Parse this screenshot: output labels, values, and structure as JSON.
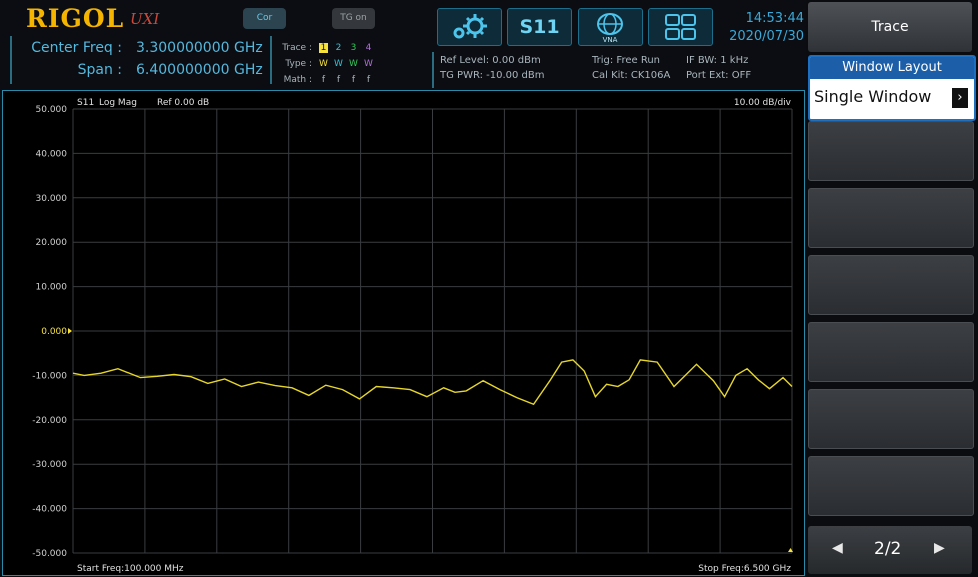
{
  "brand": {
    "logo": "RIGOL",
    "series": "UXI"
  },
  "toggles": {
    "cor": "Cor",
    "tg": "TG on"
  },
  "frequency": {
    "center_label": "Center Freq :",
    "center_value": "3.300000000 GHz",
    "span_label": "Span :",
    "span_value": "6.400000000 GHz"
  },
  "trace_table": {
    "trace_label": "Trace :",
    "type_label": "Type :",
    "math_label": "Math :",
    "traces": [
      "1",
      "2",
      "3",
      "4"
    ],
    "types": [
      "W",
      "W",
      "W",
      "W"
    ],
    "math": [
      "f",
      "f",
      "f",
      "f"
    ]
  },
  "toolbar": {
    "measurement": "S11",
    "vna_label": "VNA"
  },
  "clock": {
    "time": "14:53:44",
    "date": "2020/07/30"
  },
  "status": {
    "ref_level": "Ref Level: 0.00 dBm",
    "tg_pwr": "TG PWR: -10.00 dBm",
    "trig": "Trig: Free Run",
    "cal_kit": "Cal Kit: CK106A",
    "if_bw": "IF BW: 1 kHz",
    "port_ext": "Port Ext: OFF"
  },
  "plot": {
    "measurement_label": "S11",
    "format_label": "Log Mag",
    "ref_label": "Ref 0.00 dB",
    "scale_label": "10.00  dB/div",
    "start_label": "Start Freq:100.000 MHz",
    "stop_label": "Stop Freq:6.500 GHz"
  },
  "chart_data": {
    "type": "line",
    "title": "S11 Log Mag",
    "xlabel": "",
    "ylabel": "",
    "xlim": [
      0.1,
      6.5
    ],
    "ylim": [
      -50,
      50
    ],
    "y_ticks": [
      "50.000",
      "40.000",
      "30.000",
      "20.000",
      "10.000",
      "0.000",
      "-10.000",
      "-20.000",
      "-30.000",
      "-40.000",
      "-50.000"
    ],
    "reference_value": 0,
    "grid": true,
    "series": [
      {
        "color": "#e6d62a",
        "x": [
          0.1,
          0.2,
          0.35,
          0.5,
          0.7,
          0.85,
          1.0,
          1.15,
          1.3,
          1.45,
          1.6,
          1.75,
          1.9,
          2.05,
          2.2,
          2.35,
          2.5,
          2.65,
          2.8,
          2.95,
          3.1,
          3.25,
          3.4,
          3.5,
          3.6,
          3.75,
          3.9,
          4.05,
          4.2,
          4.35,
          4.45,
          4.55,
          4.65,
          4.75,
          4.85,
          4.95,
          5.05,
          5.15,
          5.3,
          5.45,
          5.55,
          5.65,
          5.8,
          5.9,
          6.0,
          6.1,
          6.2,
          6.3,
          6.42,
          6.5
        ],
        "y": [
          -9.5,
          -10,
          -9.5,
          -8.5,
          -10.5,
          -10.2,
          -9.8,
          -10.3,
          -11.8,
          -10.8,
          -12.5,
          -11.5,
          -12.3,
          -12.8,
          -14.5,
          -12.2,
          -13.2,
          -15.3,
          -12.5,
          -12.8,
          -13.2,
          -14.8,
          -12.8,
          -13.8,
          -13.5,
          -11.2,
          -13.2,
          -15,
          -16.5,
          -11,
          -7,
          -6.5,
          -9,
          -14.8,
          -12,
          -12.5,
          -11,
          -6.5,
          -7,
          -12.5,
          -10,
          -7.5,
          -11.2,
          -14.8,
          -10,
          -8.5,
          -11,
          -13,
          -10.5,
          -12.5
        ]
      }
    ]
  }
}
